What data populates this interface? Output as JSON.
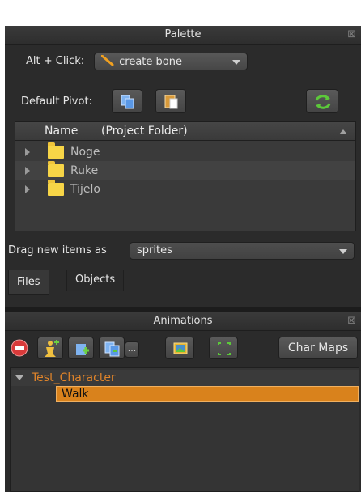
{
  "palette": {
    "title": "Palette",
    "alt_click_label": "Alt + Click:",
    "alt_click_value": "create bone",
    "default_pivot_label": "Default Pivot:",
    "tree_header": "Name",
    "tree_header_folder": "(Project Folder)",
    "items": [
      "Noge",
      "Ruke",
      "Tijelo"
    ],
    "drag_label": "Drag new items as",
    "drag_value": "sprites",
    "tabs": [
      "Files",
      "Objects"
    ]
  },
  "animations": {
    "title": "Animations",
    "char_maps_label": "Char Maps",
    "more_label": "...",
    "entity": "Test_Character",
    "animation": "Walk"
  },
  "icons": {
    "close": "close-icon",
    "pencil": "pencil-icon",
    "copy": "copy-pivot-icon",
    "paste": "paste-pivot-icon",
    "refresh": "refresh-icon",
    "delete": "delete-icon",
    "add_entity": "add-entity-icon",
    "add_animation": "add-animation-icon",
    "duplicate": "duplicate-animation-icon",
    "image": "image-icon",
    "fullscreen": "fullscreen-icon"
  },
  "colors": {
    "accent_orange": "#d9821c",
    "folder_yellow": "#f7d547",
    "refresh_green": "#5cc83a",
    "delete_red": "#d93a3a"
  }
}
